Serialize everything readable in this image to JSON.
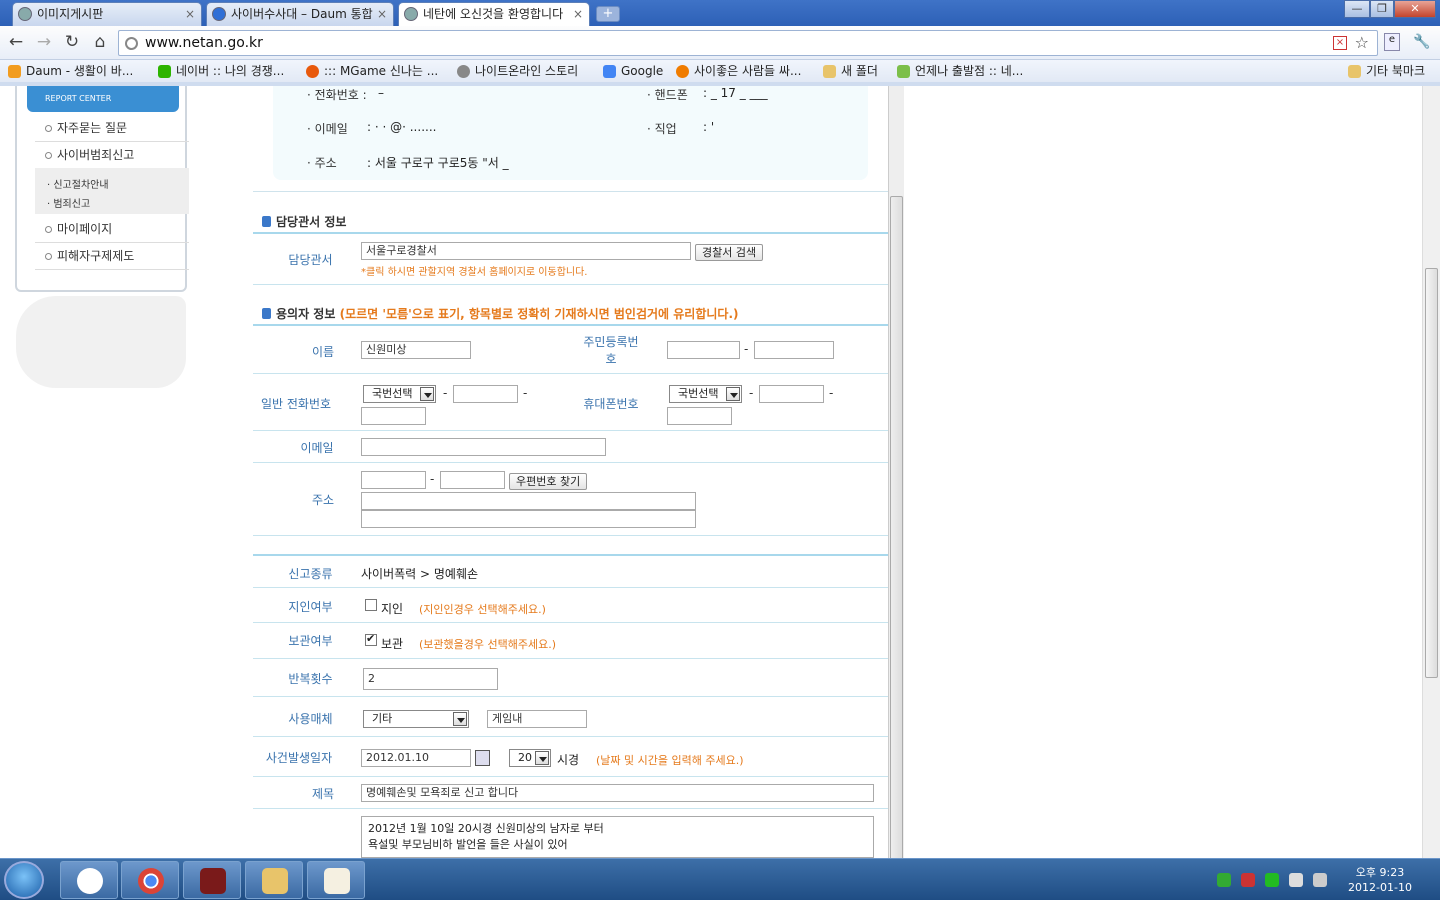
{
  "browser": {
    "tabs": [
      {
        "label": "이미지게시판",
        "close": "×"
      },
      {
        "label": "사이버수사대 – Daum 통합",
        "close": "×"
      },
      {
        "label": "네탄에 오신것을 환영합니다",
        "close": "×"
      }
    ],
    "new_tab": "+",
    "url": "www.netan.go.kr",
    "window_buttons": {
      "minimize": "—",
      "restore": "❐",
      "close": "✕"
    },
    "nav": {
      "back": "←",
      "forward": "→",
      "reload": "↻",
      "home": "⌂",
      "wrench": "🔧"
    },
    "bookmarks": [
      {
        "label": "Daum - 생활이 바...",
        "color": "#f29c1f"
      },
      {
        "label": "네이버 :: 나의 경쟁...",
        "color": "#2db400"
      },
      {
        "label": "::: MGame 신나는 ...",
        "color": "#e8590c"
      },
      {
        "label": "나이트온라인 스토리",
        "color": "#888888"
      },
      {
        "label": "Google",
        "color": "#4285f4"
      },
      {
        "label": "사이좋은 사람들 싸...",
        "color": "#f07c00"
      },
      {
        "label": "새 폴더",
        "color": "#e8c46a"
      },
      {
        "label": "언제나 출발점 :: 네...",
        "color": "#7cbf4a"
      },
      {
        "label": "기타 북마크",
        "color": "#e8c46a"
      }
    ]
  },
  "sidebar": {
    "badge_sub": "REPORT CENTER",
    "items": [
      "자주묻는 질문",
      "사이버범죄신고",
      "마이페이지",
      "피해자구제제도"
    ],
    "subitems": [
      "신고절차안내",
      "범죄신고"
    ]
  },
  "reporter_info": {
    "phone_label": "· 전화번호 :",
    "phone_value": "–",
    "mobile_label": "· 핸드폰",
    "mobile_value": ": _  17 _  ___",
    "email_label": "· 이메일",
    "email_value": ":  · ·  @·   .......",
    "job_label": "· 직업",
    "job_value": ":  '",
    "address_label": "· 주소",
    "address_value": ": 서울 구로구 구로5동  \"서        _"
  },
  "police": {
    "section_title": "담당관서 정보",
    "label": "담당관서",
    "value": "서울구로경찰서",
    "search_button": "경찰서 검색",
    "note": "*클릭 하시면 관할지역 경찰서 홈페이지로 이동합니다."
  },
  "suspect": {
    "section_title": "용의자 정보",
    "section_note": "(모르면 '모름'으로 표기, 항목별로 정확히 기재하시면 범인검거에 유리합니다.)",
    "name_label": "이름",
    "name_value": "신원미상",
    "rrn_label_1": "주민등록번",
    "rrn_label_2": "호",
    "phone_label": "일반 전화번호",
    "phone_select": "국번선택",
    "mobile_label": "휴대폰번호",
    "mobile_select": "국번선택",
    "email_label": "이메일",
    "address_label": "주소",
    "zip_button": "우편번호 찾기",
    "dash": "-"
  },
  "report": {
    "type_label": "신고종류",
    "type_value": "사이버폭력 > 명예훼손",
    "acq_label": "지인여부",
    "acq_check": "지인",
    "acq_checked": false,
    "acq_note": "(지인인경우 선택해주세요.)",
    "keep_label": "보관여부",
    "keep_check": "보관",
    "keep_checked": true,
    "keep_note": "(보관했을경우 선택해주세요.)",
    "repeat_label": "반복횟수",
    "repeat_value": "2",
    "medium_label": "사용매체",
    "medium_select": "기타",
    "medium_text": "게임내",
    "date_label": "사건발생일자",
    "date_value": "2012.01.10",
    "hour_value": "20",
    "hour_suffix": "시경",
    "date_note": "(날짜 및 시간을 입력해 주세요.)",
    "title_label": "제목",
    "title_value": "명예훼손및 모욕죄로 신고 합니다",
    "content_line1": "2012년 1월 10일 20시경  신원미상의 남자로 부터",
    "content_line2": "욕설및 부모님비하 발언을 들은 사실이 있어"
  },
  "taskbar": {
    "clock_time": "오후 9:23",
    "clock_date": "2012-01-10"
  }
}
